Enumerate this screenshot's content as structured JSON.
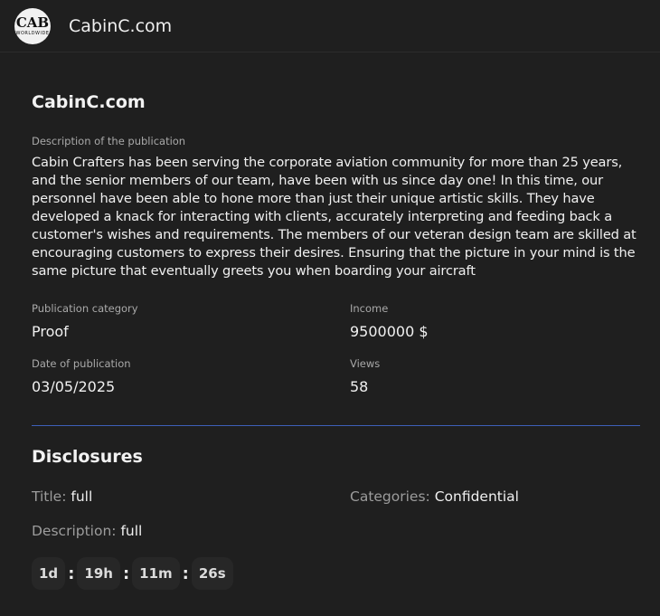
{
  "header": {
    "logo_monogram": "CAB",
    "logo_word": "WORLDWIDE",
    "site_title": "CabinC.com"
  },
  "publication": {
    "title": "CabinC.com",
    "description_label": "Description of the publication",
    "description": "Cabin Crafters has been serving the corporate aviation community for more than 25 years, and the senior members of our team, have been with us since day one! In this time, our personnel have been able to hone more than just their unique artistic skills. They have developed a knack for interacting with clients, accurately interpreting and feeding back a customer's wishes and requirements. The members of our veteran design team are skilled at encouraging customers to express their desires. Ensuring that the picture in your mind is the same picture that eventually greets you when boarding your aircraft",
    "fields": {
      "category_label": "Publication category",
      "category_value": "Proof",
      "income_label": "Income",
      "income_value": "9500000 $",
      "date_label": "Date of publication",
      "date_value": "03/05/2025",
      "views_label": "Views",
      "views_value": "58"
    }
  },
  "disclosures": {
    "title": "Disclosures",
    "title_label": "Title:",
    "title_value": "full",
    "categories_label": "Categories:",
    "categories_value": "Confidential",
    "description_label": "Description:",
    "description_value": "full"
  },
  "timer": {
    "days": "1d",
    "hours": "19h",
    "minutes": "11m",
    "seconds": "26s",
    "separator": ":"
  },
  "colors": {
    "background": "#1f1f1f",
    "divider": "#3d5fb8"
  }
}
